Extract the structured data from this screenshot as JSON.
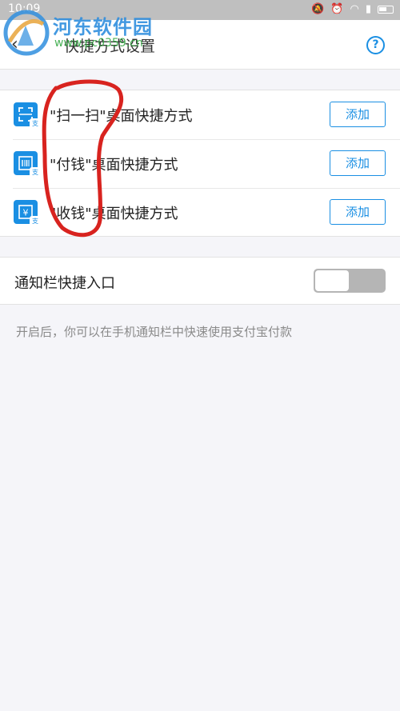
{
  "status_bar": {
    "time": "10:09",
    "icons": [
      "mute-icon",
      "alarm-icon",
      "wifi-icon",
      "signal-icon",
      "battery-icon"
    ]
  },
  "watermark": {
    "text": "河东软件园",
    "url": "www.pc0359.cn"
  },
  "header": {
    "title": "快捷方式设置",
    "help_label": "?"
  },
  "shortcuts": [
    {
      "label": "\"扫一扫\"桌面快捷方式",
      "icon": "scan-icon",
      "button": "添加"
    },
    {
      "label": "\"付钱\"桌面快捷方式",
      "icon": "barcode-icon",
      "button": "添加"
    },
    {
      "label": "\"收钱\"桌面快捷方式",
      "icon": "yuan-icon",
      "button": "添加"
    }
  ],
  "notification": {
    "label": "通知栏快捷入口",
    "enabled": false,
    "hint": "开启后，你可以在手机通知栏中快速使用支付宝付款"
  },
  "colors": {
    "accent": "#1a8fe3",
    "annotation": "#d8231f",
    "toggle_off": "#b5b5b5"
  }
}
